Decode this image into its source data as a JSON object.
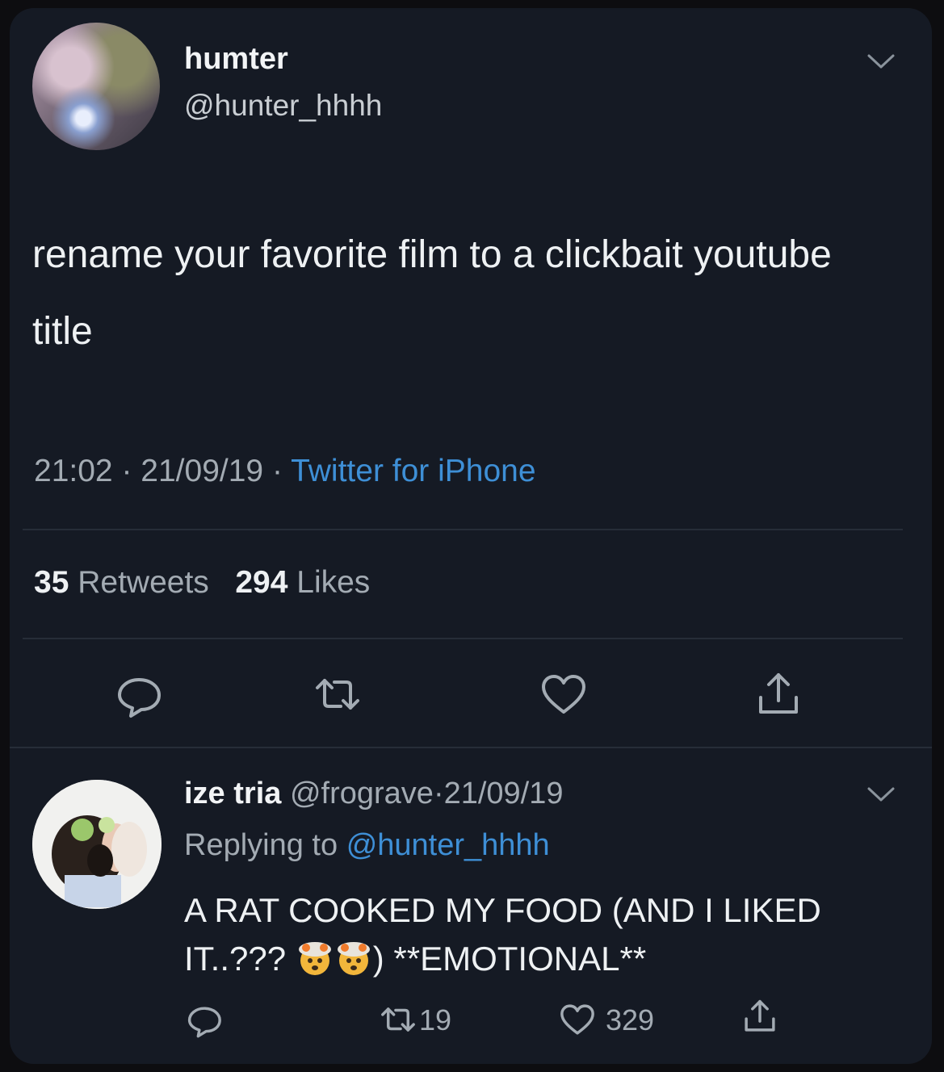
{
  "tweet": {
    "author_name": "humter",
    "author_handle": "@hunter_hhhh",
    "text": "rename your favorite film to a clickbait youtube title",
    "time": "21:02",
    "date": "21/09/19",
    "source": "Twitter for iPhone",
    "separator": "·",
    "retweets_count": "35",
    "retweets_label": "Retweets",
    "likes_count": "294",
    "likes_label": "Likes"
  },
  "reply": {
    "author_name": "ize tria",
    "author_handle": "@frograve",
    "date": "21/09/19",
    "separator": "·",
    "replying_label": "Replying to",
    "replying_to": "@hunter_hhhh",
    "text_part1": "A RAT COOKED MY FOOD (AND I LIKED IT..???",
    "text_part2": ") **EMOTIONAL**",
    "retweets_count": "19",
    "likes_count": "329"
  },
  "icons": [
    "chevron-down-icon",
    "reply-icon",
    "retweet-icon",
    "heart-icon",
    "share-icon",
    "exploding-head-emoji-icon"
  ],
  "colors": {
    "background": "#151a24",
    "link": "#3e8fd6",
    "muted_text": "#a3abb3",
    "text": "#eef1f3"
  }
}
